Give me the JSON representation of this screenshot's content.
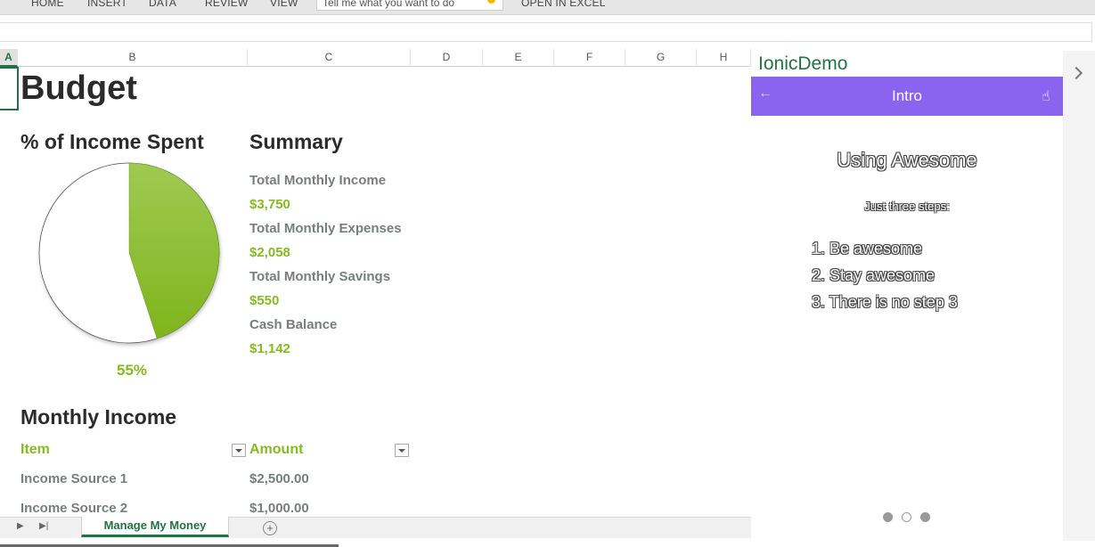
{
  "ribbon": {
    "tabs": [
      "HOME",
      "INSERT",
      "DATA",
      "REVIEW",
      "VIEW"
    ],
    "tell_me_placeholder": "Tell me what you want to do",
    "open_in_excel": "OPEN IN EXCEL"
  },
  "columns": [
    "A",
    "B",
    "C",
    "D",
    "E",
    "F",
    "G",
    "H"
  ],
  "sheet": {
    "title": "Budget",
    "pct_heading": "% of Income Spent",
    "pct_value": "55%",
    "pie": {
      "spent_percent": 45,
      "spent_color": "#86bb20",
      "rest_color": "#ffffff"
    },
    "summary_heading": "Summary",
    "summary": [
      {
        "label": "Total Monthly Income",
        "value": "$3,750"
      },
      {
        "label": "Total Monthly Expenses",
        "value": "$2,058"
      },
      {
        "label": "Total Monthly Savings",
        "value": "$550"
      },
      {
        "label": "Cash Balance",
        "value": "$1,142"
      }
    ],
    "income_heading": "Monthly Income",
    "income_table": {
      "headers": [
        "Item",
        "Amount"
      ],
      "rows": [
        [
          "Income Source 1",
          "$2,500.00"
        ],
        [
          "Income Source 2",
          "$1,000.00"
        ]
      ]
    }
  },
  "sheet_tabs": {
    "active": "Manage My Money"
  },
  "pane": {
    "title": "IonicDemo",
    "app_title": "Intro",
    "slide_heading": "Using Awesome",
    "slide_subtitle": "Just three steps:",
    "steps": [
      "1. Be awesome",
      "2. Stay awesome",
      "3. There is no step 3"
    ],
    "dots_total": 3,
    "dot_active_index": 1
  },
  "colors": {
    "accent_green": "#217346",
    "value_green": "#86bb20",
    "app_purple": "#8a64ee"
  }
}
